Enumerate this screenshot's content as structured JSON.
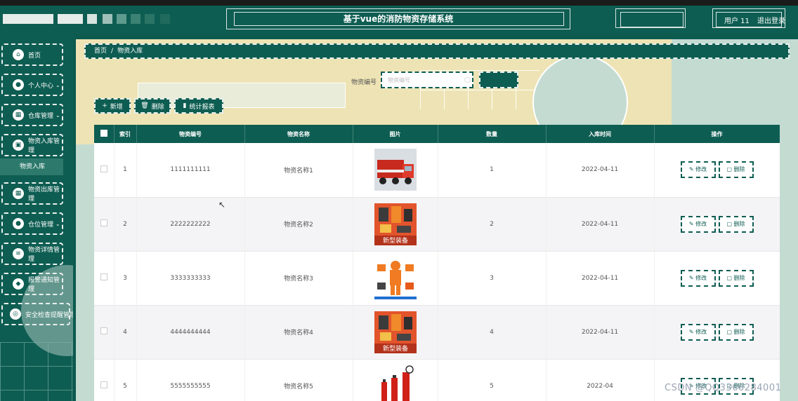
{
  "header": {
    "title": "基于vue的消防物资存储系统",
    "user": "用户 11",
    "logout": "退出登录"
  },
  "sidebar": {
    "items": [
      {
        "label": "首页",
        "icon": "home-icon",
        "arrow": ""
      },
      {
        "label": "个人中心",
        "icon": "user-icon",
        "arrow": "⌄"
      },
      {
        "label": "仓库管理",
        "icon": "grid-icon",
        "arrow": "⌄"
      },
      {
        "label": "物资入库管理",
        "icon": "box-icon",
        "arrow": ""
      },
      {
        "label": "物资出库管理",
        "icon": "grid-icon",
        "arrow": ""
      },
      {
        "label": "仓位管理",
        "icon": "user-icon",
        "arrow": "⌄"
      },
      {
        "label": "物资详情管理",
        "icon": "list-icon",
        "arrow": ""
      },
      {
        "label": "报警通知管理",
        "icon": "shield-icon",
        "arrow": ""
      },
      {
        "label": "安全检查提醒管理",
        "icon": "bell-icon",
        "arrow": ""
      }
    ],
    "active_sub": "物资入库"
  },
  "breadcrumb": {
    "home": "首页",
    "sep": "/",
    "current": "物资入库"
  },
  "search": {
    "label": "物资编号",
    "placeholder": "物资编号",
    "clear": "◯"
  },
  "toolbar": {
    "add": "新增",
    "delete": "删除",
    "stats": "统计报表"
  },
  "table": {
    "headers": [
      "索引",
      "物资编号",
      "物资名称",
      "图片",
      "数量",
      "入库时间",
      "操作"
    ],
    "rows": [
      {
        "index": "1",
        "code": "1111111111",
        "name": "物资名称1",
        "image": "fire-truck",
        "qty": "1",
        "date": "2022-04-11"
      },
      {
        "index": "2",
        "code": "2222222222",
        "name": "物资名称2",
        "image": "gear-poster",
        "qty": "2",
        "date": "2022-04-11"
      },
      {
        "index": "3",
        "code": "3333333333",
        "name": "物资名称3",
        "image": "fire-suit",
        "qty": "3",
        "date": "2022-04-11"
      },
      {
        "index": "4",
        "code": "4444444444",
        "name": "物资名称4",
        "image": "gear-poster",
        "qty": "4",
        "date": "2022-04-11"
      },
      {
        "index": "5",
        "code": "5555555555",
        "name": "物资名称5",
        "image": "extinguishers",
        "qty": "5",
        "date": "2022-04"
      }
    ],
    "edit_label": "修改",
    "delete_label": "删除",
    "poster_caption": "新型装备"
  },
  "watermark": "CSDN @QQ3360284001",
  "colors": {
    "primary": "#0e5d52",
    "bg_main": "#eee3b4",
    "accent_light": "#c4dbd2"
  }
}
